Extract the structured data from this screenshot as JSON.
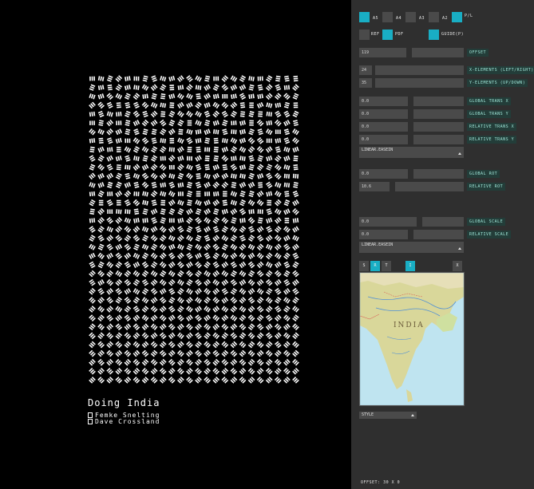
{
  "poster": {
    "title": "Doing India",
    "credit_1": "Femke Snelting",
    "credit_2": "Dave Crossland"
  },
  "panel": {
    "formats": [
      {
        "label": "A5",
        "active": true
      },
      {
        "label": "A4",
        "active": false
      },
      {
        "label": "A3",
        "active": false
      },
      {
        "label": "A2",
        "active": false
      },
      {
        "label": "P/L",
        "active": true
      }
    ],
    "toggles": [
      {
        "label": "REF",
        "active": false
      },
      {
        "label": "PDF",
        "active": true
      },
      {
        "label": "GUIDE(P)",
        "active": true
      }
    ],
    "offset": {
      "value": "119",
      "label": "OFFSET"
    },
    "x_elements": {
      "value": "24",
      "label": "X-ELEMENTS (LEFT/RIGHT)"
    },
    "y_elements": {
      "value": "35",
      "label": "Y-ELEMENTS (UP/DOWN)"
    },
    "global_trans_x": {
      "value": "0.0",
      "label": "GLOBAL TRANS X"
    },
    "global_trans_y": {
      "value": "0.0",
      "label": "GLOBAL TRANS Y"
    },
    "relative_trans_x": {
      "value": "0.0",
      "label": "RELATIVE TRANS X"
    },
    "relative_trans_y": {
      "value": "0.0",
      "label": "RELATIVE TRANS Y"
    },
    "easing_1": "LINEAR.EASEIN",
    "global_rot": {
      "value": "0.0",
      "label": "GLOBAL ROT"
    },
    "relative_rot": {
      "value": "10.6",
      "label": "RELATIVE ROT"
    },
    "global_scale": {
      "value": "0.0",
      "label": "GLOBAL SCALE"
    },
    "relative_scale": {
      "value": "0.0",
      "label": "RELATIVE SCALE"
    },
    "easing_2": "LINEAR.EASEIN",
    "tabs": [
      {
        "label": "S",
        "active": false
      },
      {
        "label": "R",
        "active": true
      },
      {
        "label": "T",
        "active": false
      },
      {
        "label": "I",
        "active": true
      },
      {
        "label": "X",
        "active": false
      }
    ],
    "map_label": "INDIA",
    "style": "STYLE",
    "status": "OFFSET: 30 X 0"
  }
}
